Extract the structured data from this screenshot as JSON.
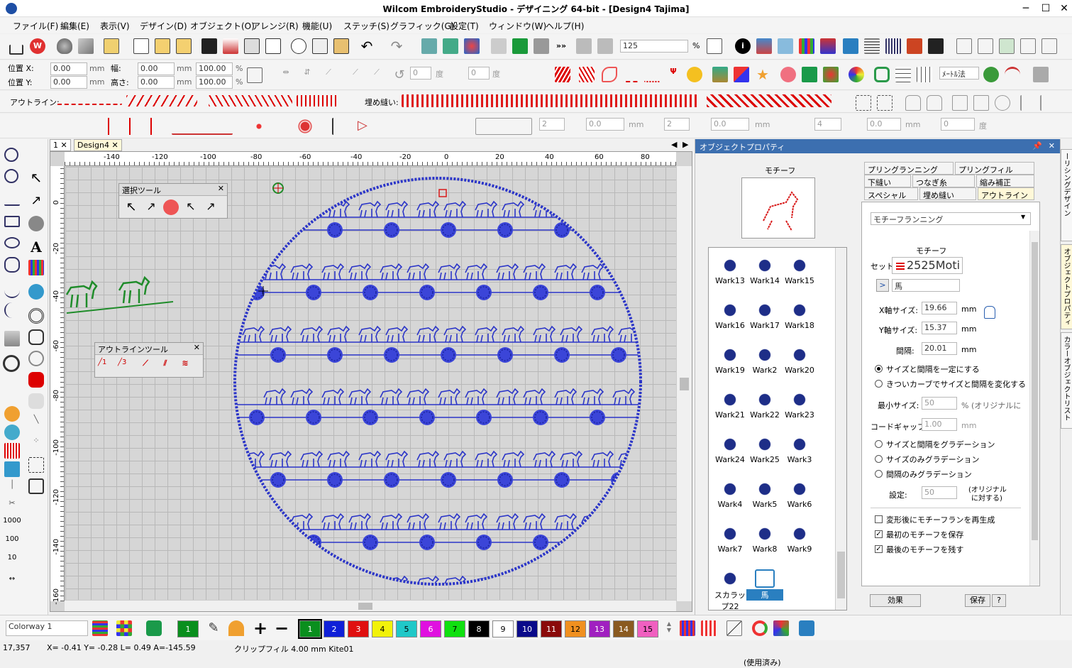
{
  "window": {
    "title": "Wilcom EmbroideryStudio - デザイニング 64-bit - [Design4       Tajima]",
    "minimize": "─",
    "maximize": "☐",
    "close": "✕"
  },
  "menu": [
    "ファイル(F)",
    "編集(E)",
    "表示(V)",
    "デザイン(D)",
    "オブジェクト(O)",
    "アレンジ(R)",
    "機能(U)",
    "ステッチ(S)",
    "グラフィック(G)",
    "設定(T)",
    "ウィンドウ(W)",
    "ヘルプ(H)"
  ],
  "zoom": {
    "value": "125",
    "unit": "%"
  },
  "position": {
    "x_label": "位置 X:",
    "y_label": "位置 Y:",
    "x": "0.00",
    "y": "0.00",
    "unit": "mm",
    "width_label": "幅:",
    "height_label": "高さ:",
    "width": "0.00",
    "height": "0.00",
    "wpct": "100.00",
    "hpct": "100.00",
    "pct": "%"
  },
  "rotate": {
    "value": "0",
    "unit": "度",
    "value2": "0"
  },
  "toolbar3": {
    "outline_label": "アウトライン:",
    "fill_label": "埋め縫い:",
    "metric": "ﾒｰﾄﾙ法"
  },
  "toolbar4": {
    "v1": "2",
    "v2": "0.0",
    "v3": "2",
    "v4": "0.0",
    "v5": "4",
    "v6": "0.0",
    "v7": "0",
    "mm": "mm",
    "deg": "度"
  },
  "doctabs": [
    {
      "label": "1"
    },
    {
      "label": "Design4"
    }
  ],
  "rulers": {
    "top": [
      "-140",
      "-120",
      "-100",
      "-80",
      "-60",
      "-40",
      "-20",
      "0",
      "20",
      "40",
      "60",
      "80"
    ],
    "left": [
      "0",
      "-20",
      "-40",
      "-60",
      "-80",
      "-100",
      "-120",
      "-140",
      "-160"
    ]
  },
  "select_tools": {
    "title": "選択ツール",
    "close": "✕"
  },
  "outline_tools": {
    "title": "アウトラインツール",
    "close": "✕",
    "n1": "1",
    "n3": "3"
  },
  "objpanel": {
    "title": "オブジェクトプロパティ",
    "pin": "📌",
    "close": "✕",
    "motif_label": "モチーフ",
    "tabs_row1": [
      "プリングランニング",
      "プリングフィル"
    ],
    "tabs_row2": [
      "下縫い",
      "つなぎ糸",
      "縮み補正"
    ],
    "tabs_row3": [
      "スペシャル",
      "埋め縫い",
      "アウトライン"
    ],
    "type_select": "モチーフランニング",
    "motif_section": "モチーフ",
    "set_label": "セット:",
    "set_value": "2525Moti",
    "motif_value": "馬",
    "next_btn": ">",
    "xsize_label": "X軸サイズ:",
    "xsize": "19.66",
    "ysize_label": "Y軸サイズ:",
    "ysize": "15.37",
    "spacing_label": "間隔:",
    "spacing": "20.01",
    "mm": "mm",
    "radio1": "サイズと間隔を一定にする",
    "radio2": "きついカーブでサイズと間隔を変化する",
    "minsize_label": "最小サイズ:",
    "minsize": "50",
    "minsize_unit": "% (オリジナルに",
    "chordgap_label": "コードギャップ:",
    "chordgap": "1.00",
    "radio3": "サイズと間隔をグラデーション",
    "radio4": "サイズのみグラデーション",
    "radio5": "間隔のみグラデーション",
    "setting_label": "設定:",
    "setting": "50",
    "setting_unit1": "(オリジナル",
    "setting_unit2": "に対する)",
    "check1": "変形後にモチーフランを再生成",
    "check2": "最初のモチーフを保存",
    "check3": "最後のモチーフを残す",
    "effect_btn": "効果",
    "save_btn": "保存",
    "help_btn": "?",
    "used": "(使用済み)"
  },
  "motifs": [
    "Wark13",
    "Wark14",
    "Wark15",
    "Wark16",
    "Wark17",
    "Wark18",
    "Wark19",
    "Wark2",
    "Wark20",
    "Wark21",
    "Wark22",
    "Wark23",
    "Wark24",
    "Wark25",
    "Wark3",
    "Wark4",
    "Wark5",
    "Wark6",
    "Wark7",
    "Wark8",
    "Wark9",
    "スカラップ22",
    "馬"
  ],
  "sidetabs": [
    "ーリシングデザイン",
    "オブジェクトプロパティ",
    "カラーオブジェクトリスト"
  ],
  "bottom": {
    "colorway": "Colorway 1",
    "current_color": "1",
    "swatches": [
      {
        "n": "1",
        "c": "#0a8f1e",
        "t": "#fff"
      },
      {
        "n": "2",
        "c": "#1020d8",
        "t": "#fff"
      },
      {
        "n": "3",
        "c": "#e01010",
        "t": "#fff"
      },
      {
        "n": "4",
        "c": "#f2f20a",
        "t": "#000"
      },
      {
        "n": "5",
        "c": "#20c8c8",
        "t": "#000"
      },
      {
        "n": "6",
        "c": "#e010e0",
        "t": "#fff"
      },
      {
        "n": "7",
        "c": "#10e010",
        "t": "#000"
      },
      {
        "n": "8",
        "c": "#000000",
        "t": "#fff"
      },
      {
        "n": "9",
        "c": "#ffffff",
        "t": "#000"
      },
      {
        "n": "10",
        "c": "#0a0a8a",
        "t": "#fff"
      },
      {
        "n": "11",
        "c": "#8a0a0a",
        "t": "#fff"
      },
      {
        "n": "12",
        "c": "#f09020",
        "t": "#000"
      },
      {
        "n": "13",
        "c": "#a020c0",
        "t": "#fff"
      },
      {
        "n": "14",
        "c": "#8a5a20",
        "t": "#fff"
      },
      {
        "n": "15",
        "c": "#f060c0",
        "t": "#000"
      }
    ]
  },
  "status": {
    "count": "17,357",
    "coords": "X=  -0.41 Y=  -0.28 L=    0.49 A=-145.59",
    "info": "クリップフィル  4.00 mm Kite01"
  },
  "colors": {
    "stitch": "#2b35c8",
    "green": "#1f8c2a",
    "red": "#d81a1a",
    "panel_header": "#3c6fb0"
  }
}
